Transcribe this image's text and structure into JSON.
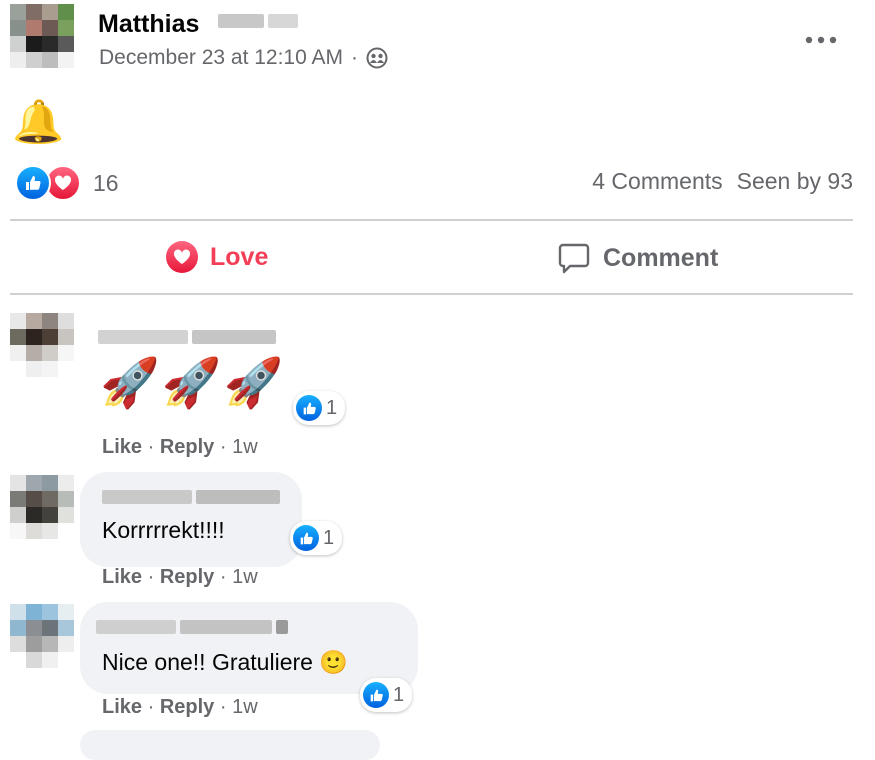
{
  "post": {
    "author_name": "Matthias",
    "timestamp": "December 23 at 12:10 AM",
    "separator": "·",
    "privacy_icon": "friends-icon",
    "more_icon": "more-options-icon",
    "content_emoji": "🔔",
    "reaction_icons": [
      "like-reaction-icon",
      "love-reaction-icon"
    ],
    "reaction_count": "16",
    "comments_count": "4 Comments",
    "seen_by": "Seen by 93"
  },
  "actions": {
    "love_label": "Love",
    "comment_label": "Comment",
    "colors": {
      "love": "#f33e58",
      "comment": "#65676b"
    }
  },
  "comments": [
    {
      "text": "🚀🚀🚀",
      "reactions": "1",
      "like": "Like",
      "reply": "Reply",
      "sep": "·",
      "time": "1w"
    },
    {
      "text": "Korrrrrekt!!!!",
      "reactions": "1",
      "like": "Like",
      "reply": "Reply",
      "sep": "·",
      "time": "1w"
    },
    {
      "text": "Nice one!! Gratuliere 🙂",
      "reactions": "1",
      "like": "Like",
      "reply": "Reply",
      "sep": "·",
      "time": "1w"
    }
  ]
}
